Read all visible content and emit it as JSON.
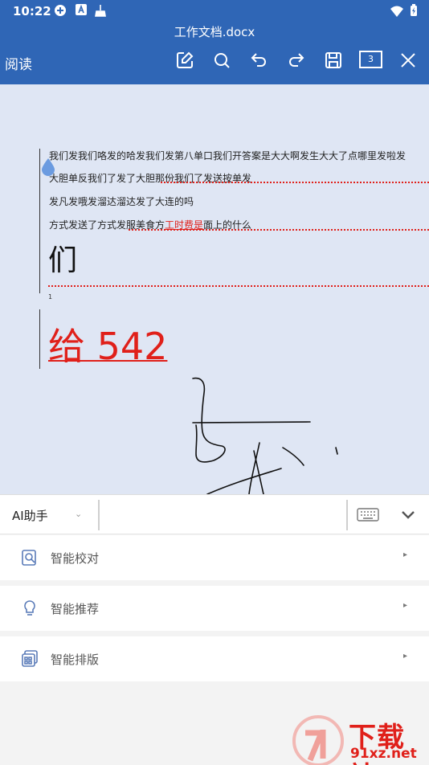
{
  "status_bar": {
    "time": "10:22"
  },
  "header": {
    "doc_title": "工作文档.docx",
    "read_label": "阅读",
    "page_count": "3"
  },
  "document": {
    "lines": [
      "我们发我们咯发的哈发我们发第八单口我们开答案是大大啊发生大大了点哪里发啦发",
      "大胆单反我们了发了大胆那份我们了发送按单发",
      "发凡发哦发溜达溜达发了大连的吗"
    ],
    "line4_before": "方式发送了方式发服美食方",
    "line4_red": "工时费是",
    "line4_after": "面上的什么",
    "big_char": "们",
    "tiny_mark": "1",
    "big_red": "给 542"
  },
  "assistant": {
    "ai_label": "AI助手",
    "features": [
      {
        "label": "智能校对",
        "icon": "proofread-icon"
      },
      {
        "label": "智能推荐",
        "icon": "bulb-icon"
      },
      {
        "label": "智能排版",
        "icon": "layout-icon"
      }
    ]
  },
  "watermark": {
    "main": "下载站",
    "sub": "91xz.net"
  },
  "colors": {
    "primary": "#2f66b6",
    "doc_bg": "#dfe6f4",
    "accent_red": "#e0201a"
  }
}
